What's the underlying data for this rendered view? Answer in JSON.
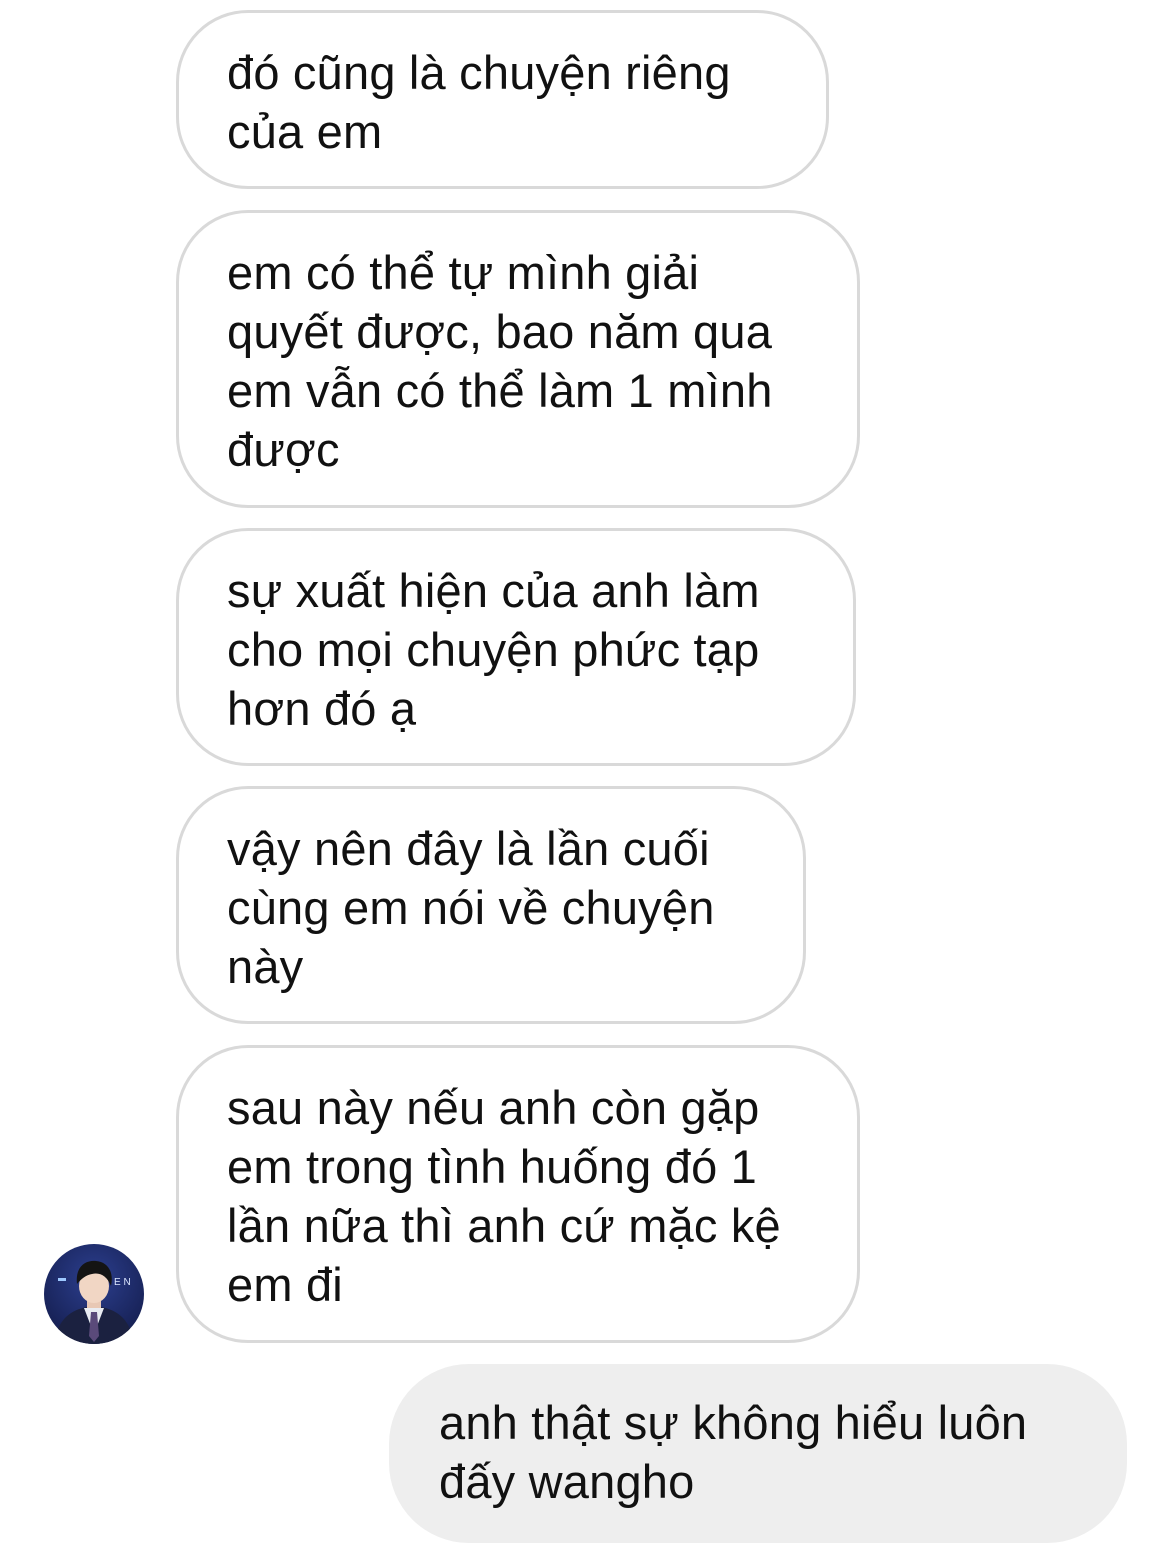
{
  "conversation": {
    "messages": [
      {
        "sender": "other",
        "lines": [
          "đó cũng là chuyện riêng",
          "của em"
        ]
      },
      {
        "sender": "other",
        "lines": [
          "em có thể tự mình giải",
          "quyết được, bao năm qua",
          "em vẫn có thể làm 1 mình",
          "được"
        ]
      },
      {
        "sender": "other",
        "lines": [
          "sự xuất hiện của anh làm",
          "cho mọi chuyện phức tạp",
          "hơn đó ạ"
        ]
      },
      {
        "sender": "other",
        "lines": [
          "vậy nên đây là lần cuối",
          "cùng em nói về chuyện",
          "này"
        ]
      },
      {
        "sender": "other",
        "lines": [
          "sau này nếu anh còn gặp",
          "em trong tình huống đó 1",
          "lần nữa thì anh cứ mặc kệ",
          "em đi"
        ]
      },
      {
        "sender": "me",
        "lines": [
          "anh thật sự không hiểu luôn",
          "đấy wangho"
        ]
      }
    ]
  },
  "avatar": {
    "overlay_text": "E N",
    "icon": "profile-photo-icon"
  },
  "colors": {
    "received_bubble_border": "#d9d9d9",
    "sent_bubble_background": "#eeeeee",
    "text": "#111111",
    "avatar_background": "#1f2e6e"
  }
}
